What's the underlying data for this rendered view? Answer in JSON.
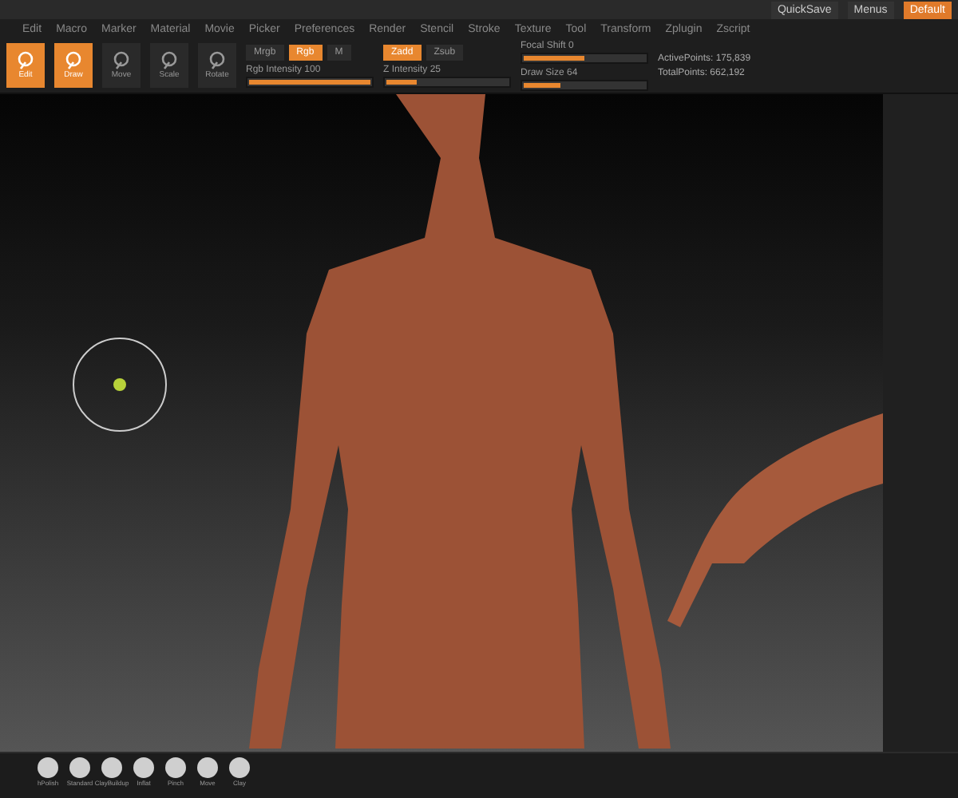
{
  "top_buttons": [
    {
      "label": "QuickSave",
      "selected": false
    },
    {
      "label": "Menus",
      "selected": false
    },
    {
      "label": "Default",
      "selected": true
    }
  ],
  "menu_bar": [
    "Edit",
    "Macro",
    "Marker",
    "Material",
    "Movie",
    "Picker",
    "Preferences",
    "Render",
    "Stencil",
    "Stroke",
    "Texture",
    "Tool",
    "Transform",
    "Zplugin",
    "Zscript"
  ],
  "toolbar": {
    "mode_buttons": [
      {
        "label": "Edit",
        "selected": true
      },
      {
        "label": "Draw",
        "selected": true
      },
      {
        "label": "Move",
        "selected": false
      },
      {
        "label": "Scale",
        "selected": false
      },
      {
        "label": "Rotate",
        "selected": false
      }
    ],
    "color_modes": [
      {
        "label": "Mrgb",
        "selected": false
      },
      {
        "label": "Rgb",
        "selected": true
      },
      {
        "label": "M",
        "selected": false
      }
    ],
    "z_modes": [
      {
        "label": "Zadd",
        "selected": true
      },
      {
        "label": "Zsub",
        "selected": false
      }
    ],
    "sliders": [
      {
        "label": "Rgb Intensity 100",
        "level": 1
      },
      {
        "label": "Z Intensity 25",
        "level": 0.25
      },
      {
        "label": "Focal Shift 0",
        "level": 0.5
      },
      {
        "label": "Draw Size 64",
        "level": 0.3
      }
    ],
    "stats": [
      "ActivePoints: 175,839",
      "TotalPoints: 662,192"
    ]
  },
  "brush_shelf": [
    "hPolish",
    "Standard",
    "ClayBuildup",
    "Inflat",
    "Pinch",
    "Move",
    "Clay"
  ]
}
